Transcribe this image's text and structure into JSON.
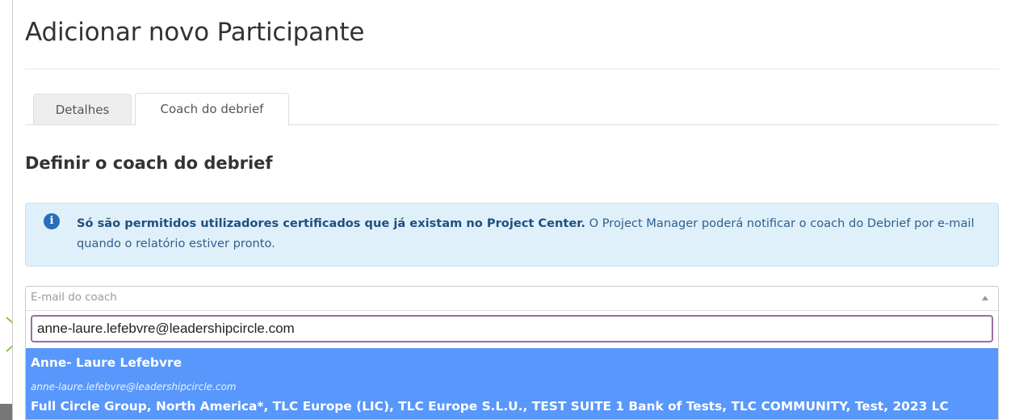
{
  "modal": {
    "title": "Adicionar novo Participante"
  },
  "tabs": [
    {
      "label": "Detalhes",
      "active": false
    },
    {
      "label": "Coach do debrief",
      "active": true
    }
  ],
  "section": {
    "title": "Definir o coach do debrief"
  },
  "alert": {
    "icon": "info-icon",
    "bold_text": "Só são permitidos utilizadores certificados que já existam no Project Center.",
    "text": " O Project Manager poderá notificar o coach do Debrief por e-mail quando o relatório estiver pronto."
  },
  "coach_select": {
    "placeholder": "E-mail do coach",
    "search_value": "anne-laure.lefebvre@leadershipcircle.com"
  },
  "result": {
    "name": "Anne- Laure Lefebvre",
    "email": "anne-laure.lefebvre@leadershipcircle.com",
    "groups": "Full Circle Group, North America*, TLC Europe (LIC), TLC Europe S.L.U., TEST SUITE 1 Bank of Tests, TLC COMMUNITY, Test, 2023 LC"
  },
  "colors": {
    "alert_bg": "#e0f0fa",
    "alert_text": "#2e5f8f",
    "highlight": "#5897fb",
    "search_border": "#9c6ba6",
    "pointer": "#8cc63f"
  }
}
